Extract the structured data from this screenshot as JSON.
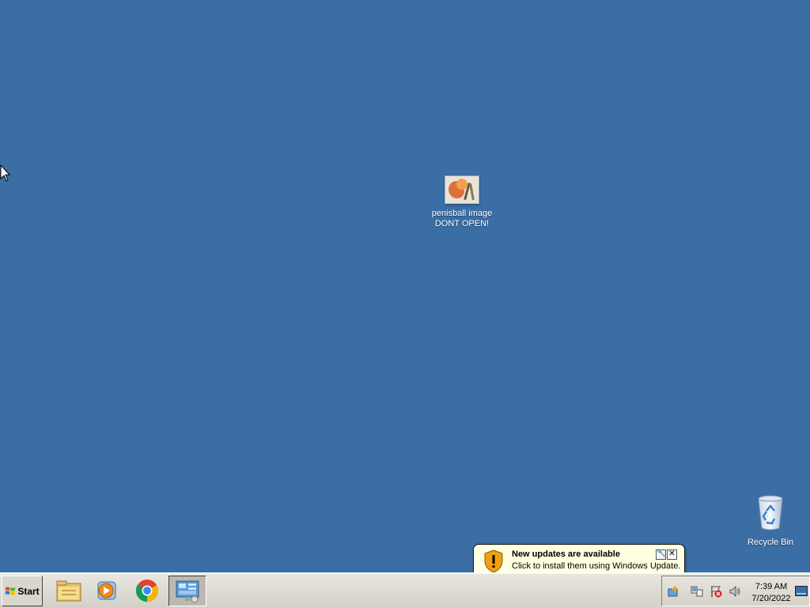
{
  "desktop": {
    "background_color": "#3b6ea5",
    "icons": [
      {
        "label_line1": "penisball image",
        "label_line2": "DONT OPEN!",
        "icon": "image-file-icon"
      },
      {
        "label": "Recycle Bin",
        "icon": "recycle-bin-icon"
      }
    ]
  },
  "notification": {
    "title": "New updates are available",
    "text": "Click to install them using Windows Update.",
    "icon": "warning-shield-icon",
    "options_label": "🔧",
    "close_label": "✕"
  },
  "taskbar": {
    "start_label": "Start",
    "pinned": [
      {
        "name": "file-explorer-icon"
      },
      {
        "name": "media-player-icon"
      },
      {
        "name": "chrome-icon"
      },
      {
        "name": "server-manager-icon",
        "active": true
      }
    ],
    "tray_icons": [
      "windows-update-icon",
      "network-icon",
      "action-center-icon",
      "volume-icon"
    ],
    "clock": {
      "time": "7:39 AM",
      "date": "7/20/2022"
    }
  }
}
